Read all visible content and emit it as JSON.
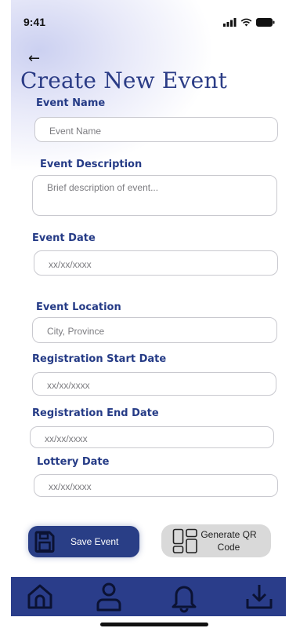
{
  "status_bar": {
    "time": "9:41"
  },
  "header": {
    "back_arrow": "←",
    "title": "Create New Event"
  },
  "form": {
    "event_name": {
      "label": "Event Name",
      "placeholder": "Event Name"
    },
    "event_description": {
      "label": "Event Description",
      "placeholder": "Brief description of event..."
    },
    "event_date": {
      "label": "Event Date",
      "placeholder": "xx/xx/xxxx"
    },
    "event_location": {
      "label": "Event Location",
      "placeholder": "City, Province"
    },
    "registration_start": {
      "label": "Registration Start Date",
      "placeholder": "xx/xx/xxxx"
    },
    "registration_end": {
      "label": "Registration End  Date",
      "placeholder": "xx/xx/xxxx"
    },
    "lottery_date": {
      "label": "Lottery Date",
      "placeholder": "xx/xx/xxxx"
    }
  },
  "actions": {
    "save_label": "Save Event",
    "qr_label_line1": "Generate QR",
    "qr_label_line2": "Code",
    "save_icon": "floppy-disk-icon",
    "qr_icon": "qr-layout-icon"
  },
  "bottom_nav": {
    "items": [
      {
        "icon": "home-icon"
      },
      {
        "icon": "profile-icon"
      },
      {
        "icon": "bell-icon"
      },
      {
        "icon": "download-icon"
      }
    ]
  },
  "colors": {
    "primary": "#2b3c86",
    "nav_bg": "#2a3d8a",
    "qr_button_bg": "#d9d9d9"
  }
}
